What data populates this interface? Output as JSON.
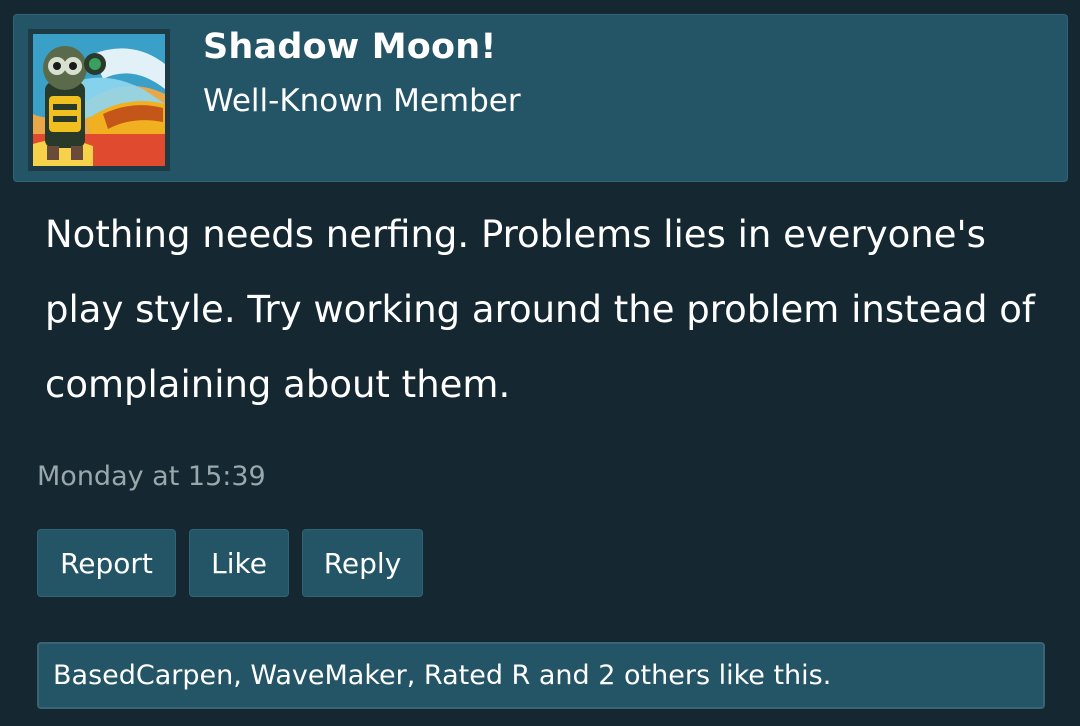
{
  "post": {
    "author": {
      "name": "Shadow Moon!",
      "title": "Well-Known Member",
      "avatar_icon": "avatar-image"
    },
    "message": "Nothing needs nerfing. Problems lies in everyone's play style. Try working around the problem instead of complaining about them.",
    "timestamp": "Monday at 15:39",
    "actions": {
      "report": "Report",
      "like": "Like",
      "reply": "Reply"
    },
    "likes_summary": "BasedCarpen, WaveMaker, Rated R and 2 others like this."
  },
  "colors": {
    "background": "#152832",
    "panel": "#245567",
    "muted_text": "#9aa8ad"
  }
}
